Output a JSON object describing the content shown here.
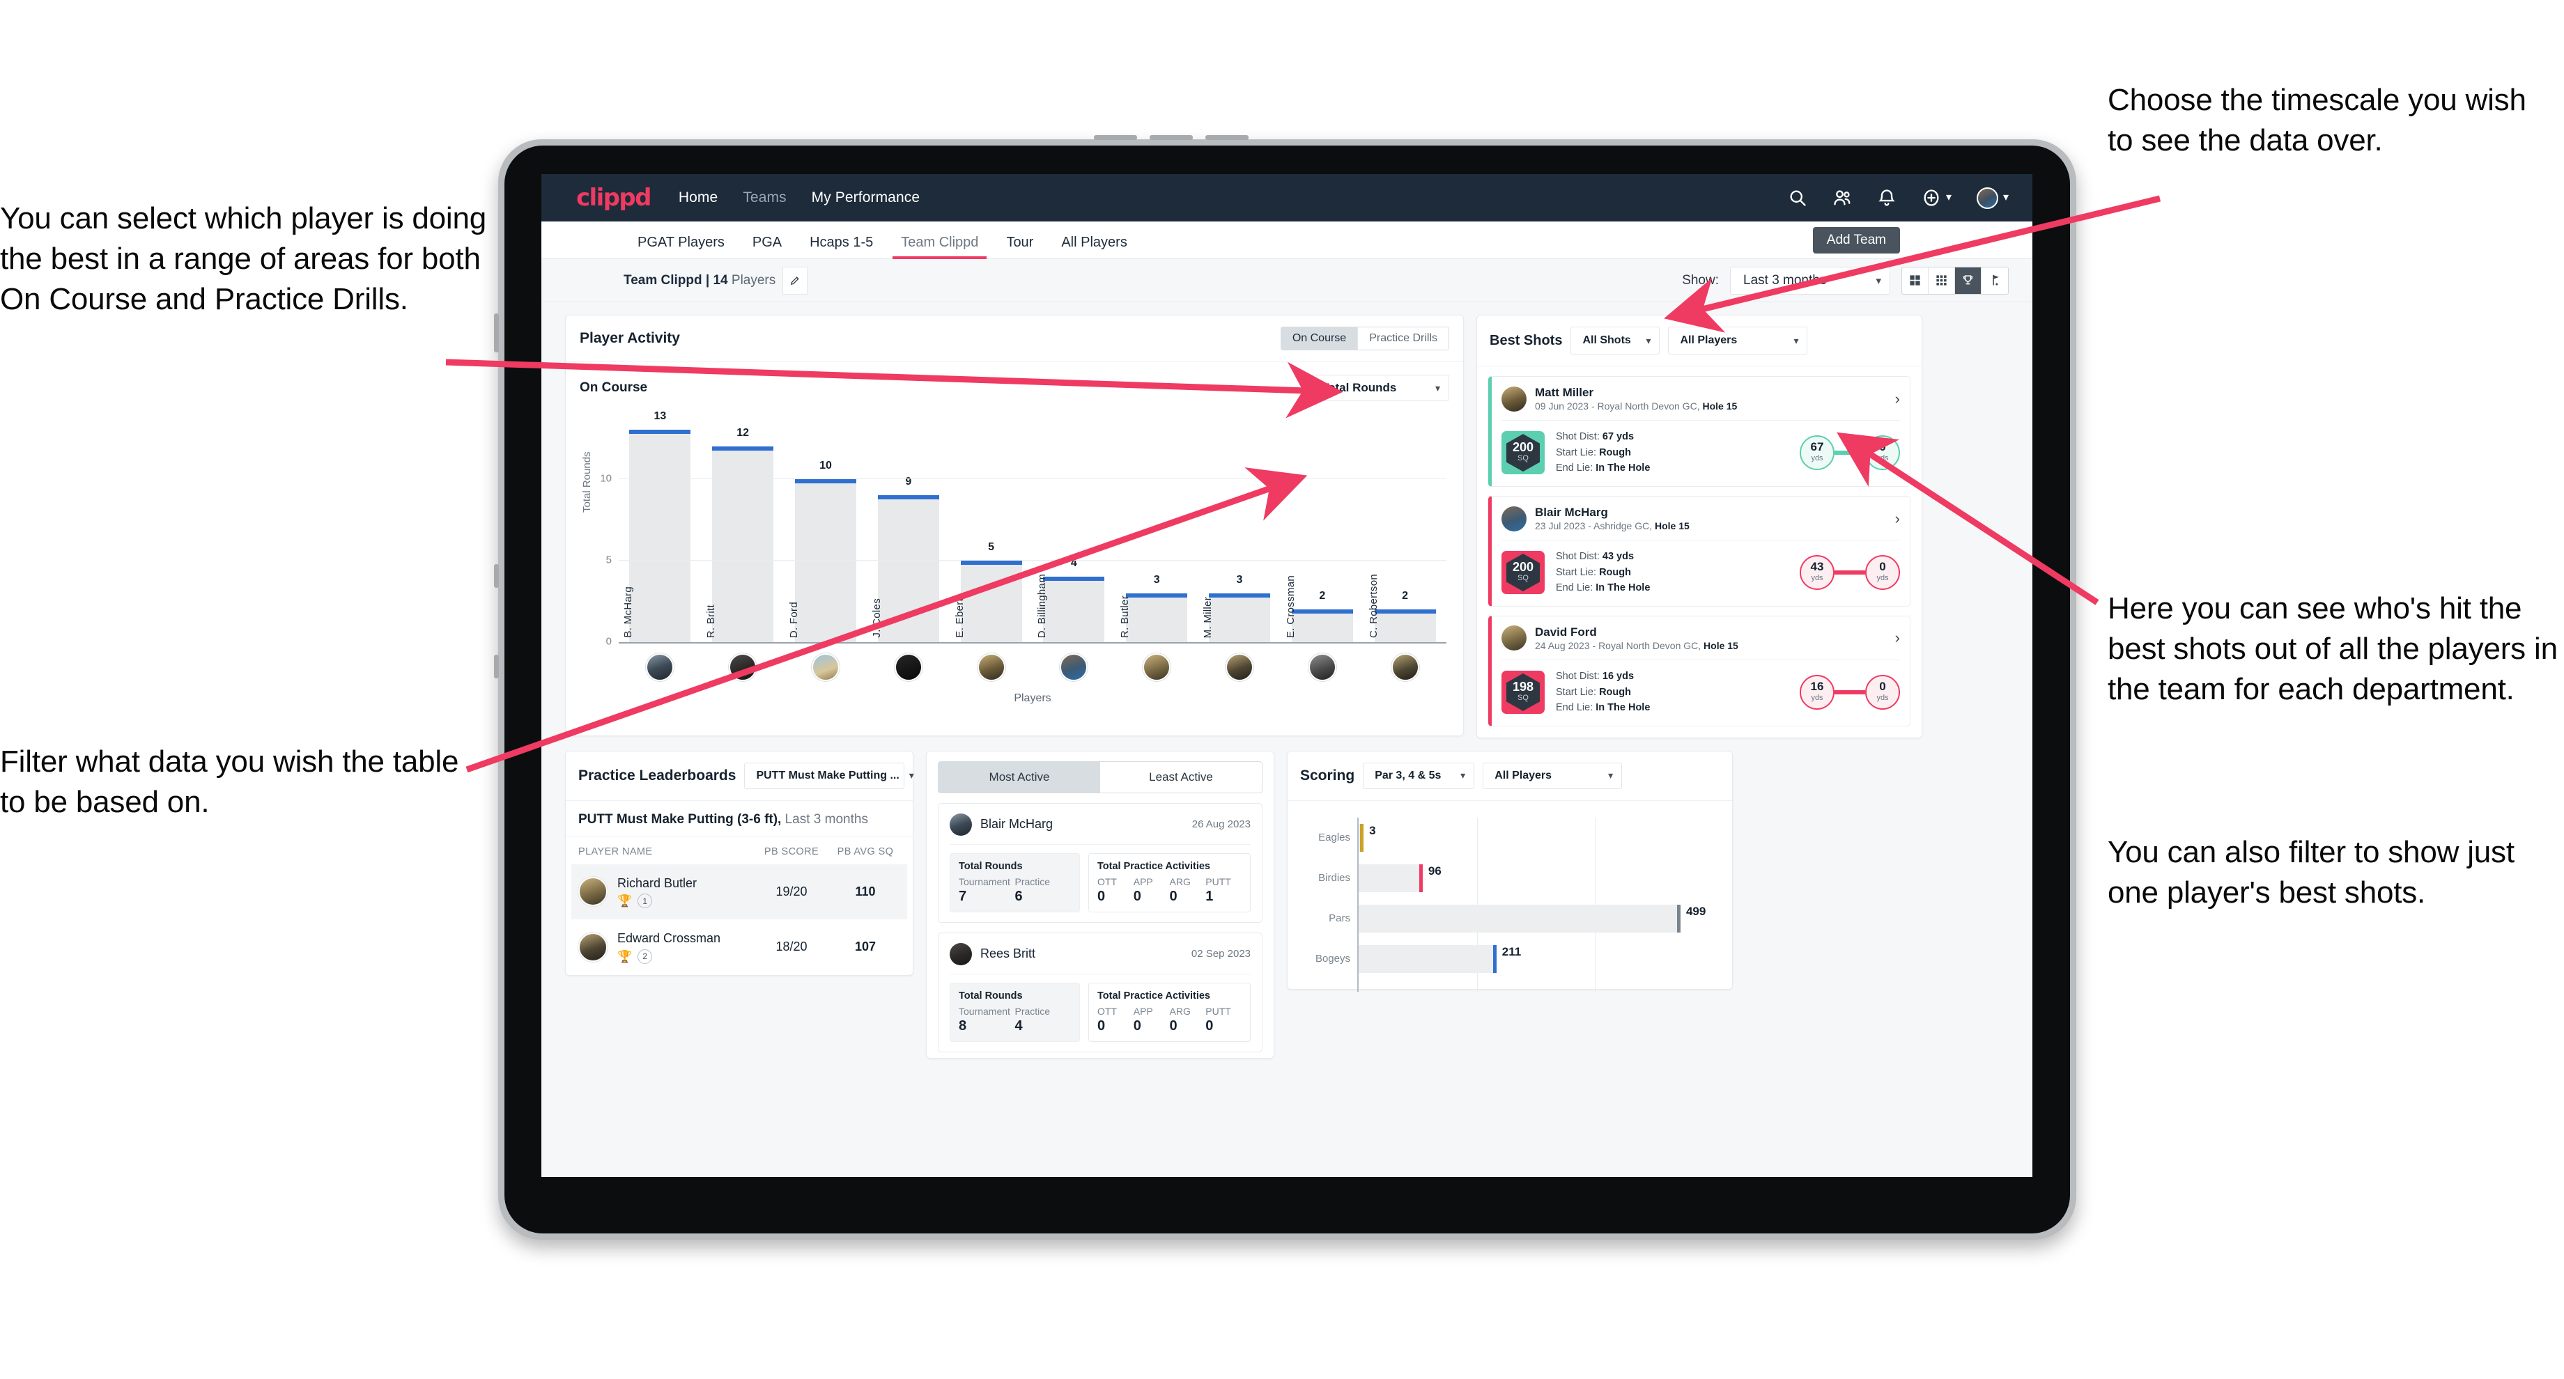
{
  "annotations": {
    "left_top": "You can select which player is doing the best in a range of areas for both On Course and Practice Drills.",
    "left_bottom": "Filter what data you wish the table to be based on.",
    "right_top": "Choose the timescale you wish to see the data over.",
    "right_mid": "Here you can see who's hit the best shots out of all the players in the team for each department.",
    "right_bottom": "You can also filter to show just one player's best shots."
  },
  "colors": {
    "brand_pink": "#ef3a62",
    "nav_dark": "#1d2b3a",
    "bar_blue": "#2f6fd0",
    "teal": "#5ccfb0",
    "gold": "#c9a227"
  },
  "topnav": {
    "logo": "clippd",
    "links": [
      {
        "label": "Home",
        "dim": false
      },
      {
        "label": "Teams",
        "dim": true
      },
      {
        "label": "My Performance",
        "dim": false
      }
    ],
    "icons": [
      "search-icon",
      "people-icon",
      "bell-icon",
      "plus-circle-icon",
      "avatar"
    ]
  },
  "tabs": {
    "items": [
      {
        "label": "PGAT Players",
        "active": false
      },
      {
        "label": "PGA",
        "active": false
      },
      {
        "label": "Hcaps 1-5",
        "active": false
      },
      {
        "label": "Team Clippd",
        "active": true
      },
      {
        "label": "Tour",
        "active": false
      },
      {
        "label": "All Players",
        "active": false
      }
    ],
    "tooltip": "Add Team"
  },
  "subbar": {
    "team_name": "Team Clippd",
    "separator": " | ",
    "player_count": "14",
    "players_word": " Players",
    "edit_icon": "pencil-icon",
    "show_label": "Show:",
    "timescale_value": "Last 3 months",
    "view_buttons": [
      {
        "icon": "grid-large-icon",
        "active": false
      },
      {
        "icon": "grid-small-icon",
        "active": false
      },
      {
        "icon": "trophy-icon",
        "active": true
      },
      {
        "icon": "flag-icon",
        "active": false
      }
    ]
  },
  "player_activity": {
    "title": "Player Activity",
    "segmented": [
      {
        "label": "On Course",
        "active": true
      },
      {
        "label": "Practice Drills",
        "active": false
      }
    ],
    "sub_label": "On Course",
    "metric_select": "Total Rounds"
  },
  "chart_data": [
    {
      "type": "bar",
      "title": "Player Activity - On Course",
      "xlabel": "Players",
      "ylabel": "Total Rounds",
      "ylim": [
        0,
        14
      ],
      "yticks": [
        0,
        5,
        10
      ],
      "grid": true,
      "categories": [
        "B. McHarg",
        "R. Britt",
        "D. Ford",
        "J. Coles",
        "E. Ebert",
        "D. Billingham",
        "R. Butler",
        "M. Miller",
        "E. Crossman",
        "C. Robertson"
      ],
      "values": [
        13,
        12,
        10,
        9,
        5,
        4,
        3,
        3,
        2,
        2
      ]
    },
    {
      "type": "bar",
      "title": "Scoring",
      "orientation": "horizontal",
      "xlabel": "",
      "ylabel": "",
      "grid": true,
      "categories": [
        "Eagles",
        "Birdies",
        "Pars",
        "Bogeys"
      ],
      "values": [
        3,
        96,
        499,
        211
      ],
      "xlim": [
        0,
        560
      ]
    }
  ],
  "best_shots": {
    "title": "Best Shots",
    "shot_filter": "All Shots",
    "player_filter": "All Players",
    "cards": [
      {
        "name": "Matt Miller",
        "meta_date": "09 Jun 2023 - Royal North Devon GC, ",
        "meta_hole": "Hole 15",
        "sq_value": "200",
        "sq_unit": "SQ",
        "accent": "#5ccfb0",
        "shot_dist_label": "Shot Dist: ",
        "shot_dist": "67 yds",
        "start_lie_label": "Start Lie: ",
        "start_lie": "Rough",
        "end_lie_label": "End Lie: ",
        "end_lie": "In The Hole",
        "from_value": "67",
        "from_unit": "yds",
        "to_value": "0",
        "to_unit": "yds"
      },
      {
        "name": "Blair McHarg",
        "meta_date": "23 Jul 2023 - Ashridge GC, ",
        "meta_hole": "Hole 15",
        "sq_value": "200",
        "sq_unit": "SQ",
        "accent": "#ef3a62",
        "shot_dist_label": "Shot Dist: ",
        "shot_dist": "43 yds",
        "start_lie_label": "Start Lie: ",
        "start_lie": "Rough",
        "end_lie_label": "End Lie: ",
        "end_lie": "In The Hole",
        "from_value": "43",
        "from_unit": "yds",
        "to_value": "0",
        "to_unit": "yds"
      },
      {
        "name": "David Ford",
        "meta_date": "24 Aug 2023 - Royal North Devon GC, ",
        "meta_hole": "Hole 15",
        "sq_value": "198",
        "sq_unit": "SQ",
        "accent": "#ef3a62",
        "shot_dist_label": "Shot Dist: ",
        "shot_dist": "16 yds",
        "start_lie_label": "Start Lie: ",
        "start_lie": "Rough",
        "end_lie_label": "End Lie: ",
        "end_lie": "In The Hole",
        "from_value": "16",
        "from_unit": "yds",
        "to_value": "0",
        "to_unit": "yds"
      }
    ]
  },
  "practice_leaderboards": {
    "title": "Practice Leaderboards",
    "drill_select": "PUTT Must Make Putting ...",
    "sub_title": "PUTT Must Make Putting (3-6 ft),",
    "sub_period": " Last 3 months",
    "columns": [
      "PLAYER NAME",
      "PB SCORE",
      "PB AVG SQ"
    ],
    "rows": [
      {
        "name": "Richard Butler",
        "rank": "1",
        "trophy": "gold",
        "pb_score": "19/20",
        "pb_avg_sq": "110",
        "highlight": true
      },
      {
        "name": "Edward Crossman",
        "rank": "2",
        "trophy": "silver",
        "pb_score": "18/20",
        "pb_avg_sq": "107",
        "highlight": false
      }
    ]
  },
  "activity_panel": {
    "tabs": [
      {
        "label": "Most Active",
        "active": true
      },
      {
        "label": "Least Active",
        "active": false
      }
    ],
    "cards": [
      {
        "name": "Blair McHarg",
        "date": "26 Aug 2023",
        "rounds_title": "Total Rounds",
        "rounds": [
          {
            "key": "Tournament",
            "value": "7"
          },
          {
            "key": "Practice",
            "value": "6"
          }
        ],
        "practice_title": "Total Practice Activities",
        "practice": [
          {
            "key": "OTT",
            "value": "0"
          },
          {
            "key": "APP",
            "value": "0"
          },
          {
            "key": "ARG",
            "value": "0"
          },
          {
            "key": "PUTT",
            "value": "1"
          }
        ]
      },
      {
        "name": "Rees Britt",
        "date": "02 Sep 2023",
        "rounds_title": "Total Rounds",
        "rounds": [
          {
            "key": "Tournament",
            "value": "8"
          },
          {
            "key": "Practice",
            "value": "4"
          }
        ],
        "practice_title": "Total Practice Activities",
        "practice": [
          {
            "key": "OTT",
            "value": "0"
          },
          {
            "key": "APP",
            "value": "0"
          },
          {
            "key": "ARG",
            "value": "0"
          },
          {
            "key": "PUTT",
            "value": "0"
          }
        ]
      }
    ]
  },
  "scoring": {
    "title": "Scoring",
    "par_filter": "Par 3, 4 & 5s",
    "player_filter": "All Players",
    "bars": [
      {
        "category": "Eagles",
        "value": "3",
        "pct": 0.6,
        "color": "#c9a227"
      },
      {
        "category": "Birdies",
        "value": "96",
        "pct": 17.1,
        "color": "#ef3a62"
      },
      {
        "category": "Pars",
        "value": "499",
        "pct": 89.1,
        "color": "#7a848e"
      },
      {
        "category": "Bogeys",
        "value": "211",
        "pct": 37.7,
        "color": "#2f6fd0"
      }
    ]
  }
}
